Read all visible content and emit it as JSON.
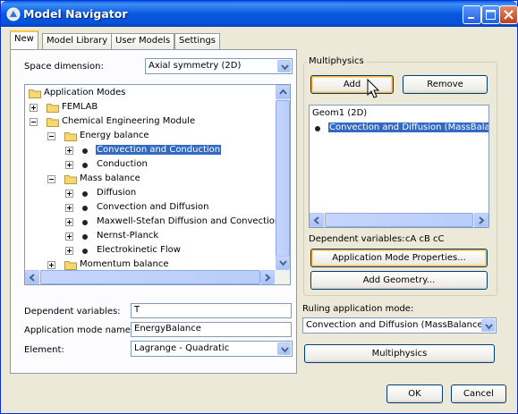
{
  "window": {
    "title": "Model Navigator"
  },
  "tabs": [
    "New",
    "Model Library",
    "User Models",
    "Settings"
  ],
  "space_dimension": {
    "label": "Space dimension:",
    "value": "Axial symmetry (2D)"
  },
  "tree": {
    "root": "Application Modes",
    "items": [
      {
        "label": "FEMLAB"
      },
      {
        "label": "Chemical Engineering Module"
      },
      {
        "label": "Energy balance"
      },
      {
        "label": "Convection and Conduction",
        "selected": true
      },
      {
        "label": "Conduction"
      },
      {
        "label": "Mass balance"
      },
      {
        "label": "Diffusion"
      },
      {
        "label": "Convection and Diffusion"
      },
      {
        "label": "Maxwell-Stefan Diffusion and Convection"
      },
      {
        "label": "Nernst-Planck"
      },
      {
        "label": "Electrokinetic Flow"
      },
      {
        "label": "Momentum balance"
      }
    ]
  },
  "fields": {
    "dependent_variables": {
      "label": "Dependent variables:",
      "value": "T"
    },
    "app_mode_name": {
      "label": "Application mode name:",
      "value": "EnergyBalance"
    },
    "element": {
      "label": "Element:",
      "value": "Lagrange - Quadratic"
    }
  },
  "multiphysics": {
    "group_label": "Multiphysics",
    "add": "Add",
    "remove": "Remove",
    "list": {
      "geom": "Geom1 (2D)",
      "item": "Convection and Diffusion (MassBalance)"
    },
    "dependent_variables_label": "Dependent variables:",
    "dependent_variables_value": "cA cB cC",
    "app_mode_properties": "Application Mode Properties...",
    "add_geometry": "Add Geometry...",
    "ruling_label": "Ruling application mode:",
    "ruling_value": "Convection and Diffusion (MassBalance)",
    "multiphysics_button": "Multiphysics"
  },
  "footer": {
    "ok": "OK",
    "cancel": "Cancel"
  },
  "colors": {
    "title_bar": "#0a58e0",
    "selection": "#316ac5",
    "dialog_bg": "#ece9d8"
  }
}
